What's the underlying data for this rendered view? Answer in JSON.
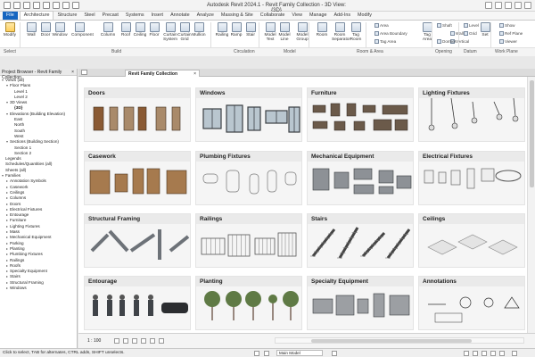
{
  "window": {
    "title": "Autodesk Revit 2024.1 - Revit Family Collection - 3D View: {3D}"
  },
  "tabs": [
    "File",
    "Architecture",
    "Structure",
    "Steel",
    "Precast",
    "Systems",
    "Insert",
    "Annotate",
    "Analyze",
    "Massing & Site",
    "Collaborate",
    "View",
    "Manage",
    "Add-Ins",
    "Modify"
  ],
  "ribbon": {
    "tools": [
      "Modify",
      "Wall",
      "Door",
      "Window",
      "Component",
      "Column",
      "Roof",
      "Ceiling",
      "Floor",
      "Curtain System",
      "Curtain Grid",
      "Mullion",
      "Railing",
      "Ramp",
      "Stair",
      "Model Text",
      "Model Line",
      "Model Group",
      "Room",
      "Room Separator",
      "Tag Room",
      "Area",
      "Area Boundary",
      "Tag Area",
      "Tag Area",
      "By Face",
      "Shaft",
      "Wall",
      "Vertical",
      "Dormer",
      "Level",
      "Grid",
      "Set",
      "Show",
      "Ref Plane",
      "Viewer"
    ],
    "small": [
      "Area",
      "Area Boundary",
      "Tag Area",
      "Shaft",
      "Wall",
      "Vertical",
      "Dormer",
      "Level",
      "Grid",
      "Show",
      "Ref Plane",
      "Viewer"
    ],
    "panels": [
      "Select",
      "Build",
      "Circulation",
      "Model",
      "Room & Area",
      "Opening",
      "Datum",
      "Work Plane"
    ]
  },
  "project_browser": {
    "title": "Project Browser - Revit Family Collection",
    "tree": [
      {
        "t": "Views (all)",
        "d": 0,
        "g": "-"
      },
      {
        "t": "Floor Plans",
        "d": 1,
        "g": "-"
      },
      {
        "t": "Level 1",
        "d": 2,
        "g": ""
      },
      {
        "t": "Level 2",
        "d": 2,
        "g": ""
      },
      {
        "t": "3D Views",
        "d": 1,
        "g": "-"
      },
      {
        "t": "{3D}",
        "d": 2,
        "g": "",
        "b": true
      },
      {
        "t": "Elevations (Building Elevation)",
        "d": 1,
        "g": "-"
      },
      {
        "t": "East",
        "d": 2,
        "g": ""
      },
      {
        "t": "North",
        "d": 2,
        "g": ""
      },
      {
        "t": "South",
        "d": 2,
        "g": ""
      },
      {
        "t": "West",
        "d": 2,
        "g": ""
      },
      {
        "t": "Sections (Building Section)",
        "d": 1,
        "g": "-"
      },
      {
        "t": "Section 1",
        "d": 2,
        "g": ""
      },
      {
        "t": "Section 2",
        "d": 2,
        "g": ""
      },
      {
        "t": "Legends",
        "d": 0,
        "g": ""
      },
      {
        "t": "Schedules/Quantities (all)",
        "d": 0,
        "g": ""
      },
      {
        "t": "Sheets (all)",
        "d": 0,
        "g": ""
      },
      {
        "t": "Families",
        "d": 0,
        "g": "-"
      },
      {
        "t": "Annotation Symbols",
        "d": 1,
        "g": "+"
      },
      {
        "t": "Casework",
        "d": 1,
        "g": "+"
      },
      {
        "t": "Ceilings",
        "d": 1,
        "g": "+"
      },
      {
        "t": "Columns",
        "d": 1,
        "g": "+"
      },
      {
        "t": "Doors",
        "d": 1,
        "g": "+"
      },
      {
        "t": "Electrical Fixtures",
        "d": 1,
        "g": "+"
      },
      {
        "t": "Entourage",
        "d": 1,
        "g": "+"
      },
      {
        "t": "Furniture",
        "d": 1,
        "g": "+"
      },
      {
        "t": "Lighting Fixtures",
        "d": 1,
        "g": "+"
      },
      {
        "t": "Mass",
        "d": 1,
        "g": "+"
      },
      {
        "t": "Mechanical Equipment",
        "d": 1,
        "g": "+"
      },
      {
        "t": "Parking",
        "d": 1,
        "g": "+"
      },
      {
        "t": "Planting",
        "d": 1,
        "g": "+"
      },
      {
        "t": "Plumbing Fixtures",
        "d": 1,
        "g": "+"
      },
      {
        "t": "Railings",
        "d": 1,
        "g": "+"
      },
      {
        "t": "Roofs",
        "d": 1,
        "g": "+"
      },
      {
        "t": "Specialty Equipment",
        "d": 1,
        "g": "+"
      },
      {
        "t": "Stairs",
        "d": 1,
        "g": "+"
      },
      {
        "t": "Structural Framing",
        "d": 1,
        "g": "+"
      },
      {
        "t": "Windows",
        "d": 1,
        "g": "+"
      }
    ]
  },
  "view_tab": {
    "label": "Revit Family Collection"
  },
  "categories": [
    "Doors",
    "Windows",
    "Furniture",
    "Lighting Fixtures",
    "Casework",
    "Plumbing Fixtures",
    "Mechanical Equipment",
    "Electrical Fixtures",
    "Structural Framing",
    "Railings",
    "Stairs",
    "Ceilings",
    "Entourage",
    "Planting",
    "Specialty Equipment",
    "Annotations"
  ],
  "view_control": {
    "scale": "1 : 100"
  },
  "status": {
    "message": "Click to select, TAB for alternates, CTRL adds, SHIFT unselects.",
    "model": "Main Model"
  },
  "colors": {
    "file_tab": "#1565c0",
    "canvas": "#ffffff",
    "card": "#f5f5f5"
  }
}
